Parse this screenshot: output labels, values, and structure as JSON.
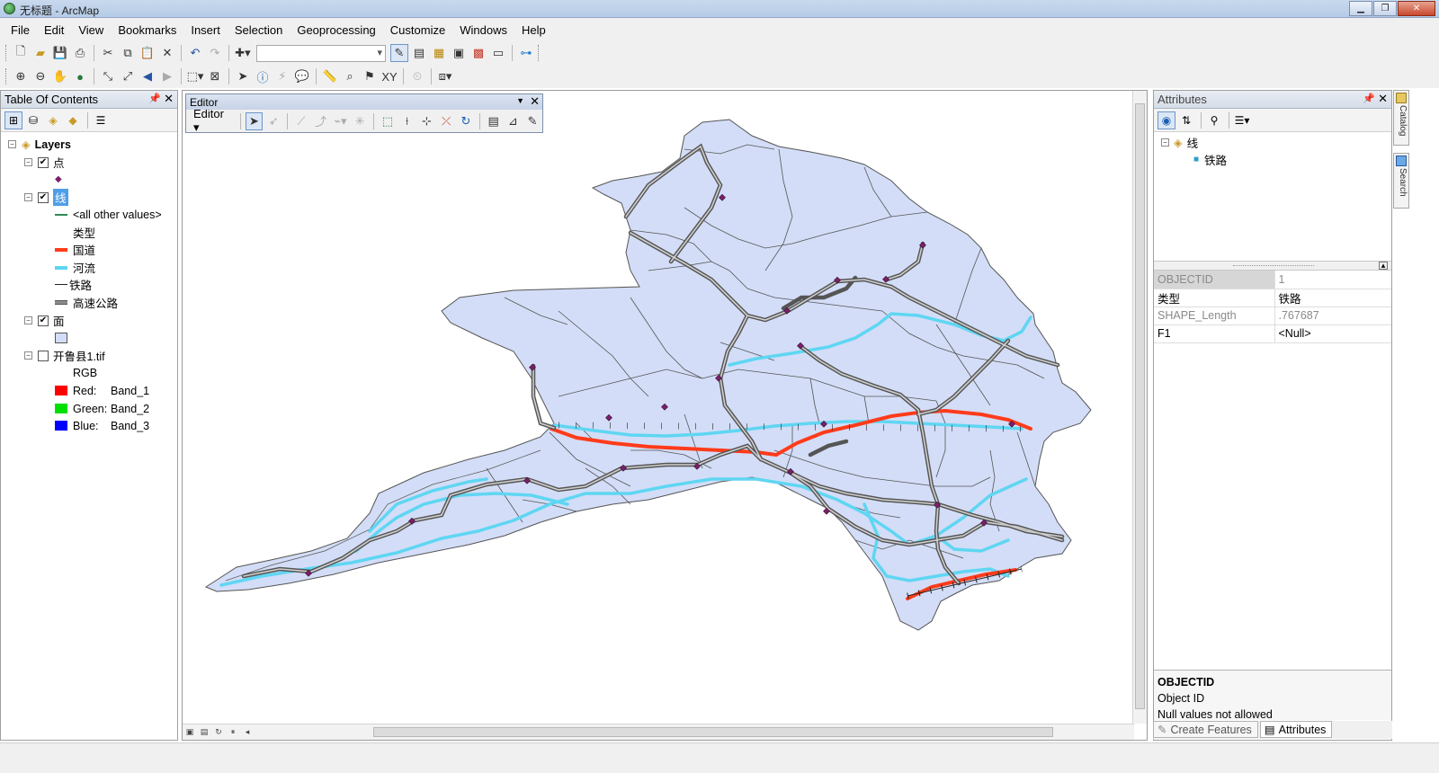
{
  "window": {
    "title": "无标题 - ArcMap"
  },
  "menu": [
    "File",
    "Edit",
    "View",
    "Bookmarks",
    "Insert",
    "Selection",
    "Geoprocessing",
    "Customize",
    "Windows",
    "Help"
  ],
  "toc": {
    "title": "Table Of Contents",
    "root": "Layers",
    "layers": {
      "points": {
        "name": "点"
      },
      "lines": {
        "name": "线",
        "all_other": "<all other values>",
        "field": "类型",
        "classes": [
          {
            "label": "国道",
            "color": "#ff3b1a"
          },
          {
            "label": "河流",
            "color": "#5fd6f2"
          },
          {
            "label": "铁路",
            "color": "#222222"
          },
          {
            "label": "高速公路",
            "color": "#8c8c8c"
          }
        ]
      },
      "polygons": {
        "name": "面",
        "fill": "#d3ddf7"
      },
      "raster": {
        "name": "开鲁县1.tif",
        "type": "RGB",
        "bands": [
          {
            "label": "Red:",
            "band": "Band_1",
            "color": "#ff0000"
          },
          {
            "label": "Green:",
            "band": "Band_2",
            "color": "#00e000"
          },
          {
            "label": "Blue:",
            "band": "Band_3",
            "color": "#0000ff"
          }
        ]
      }
    }
  },
  "editor": {
    "title": "Editor",
    "menu_label": "Editor"
  },
  "attributes": {
    "title": "Attributes",
    "tree": {
      "layer": "线",
      "feature": "铁路"
    },
    "rows": [
      {
        "key": "OBJECTID",
        "value": "1"
      },
      {
        "key": "类型",
        "value": "铁路"
      },
      {
        "key": "SHAPE_Length",
        "value": ".767687"
      },
      {
        "key": "F1",
        "value": "<Null>"
      }
    ],
    "description": {
      "field": "OBJECTID",
      "alias": "Object ID",
      "note": "Null values not allowed"
    }
  },
  "bottom_tabs": [
    "Create Features",
    "Attributes"
  ],
  "side_tabs": [
    "Catalog",
    "Search"
  ],
  "colors": {
    "polygon_fill": "#d3ddf7",
    "road": "#ff3b1a",
    "river": "#5fd6f2",
    "highway": "#8c8c8c",
    "point": "#7a1f6b"
  }
}
